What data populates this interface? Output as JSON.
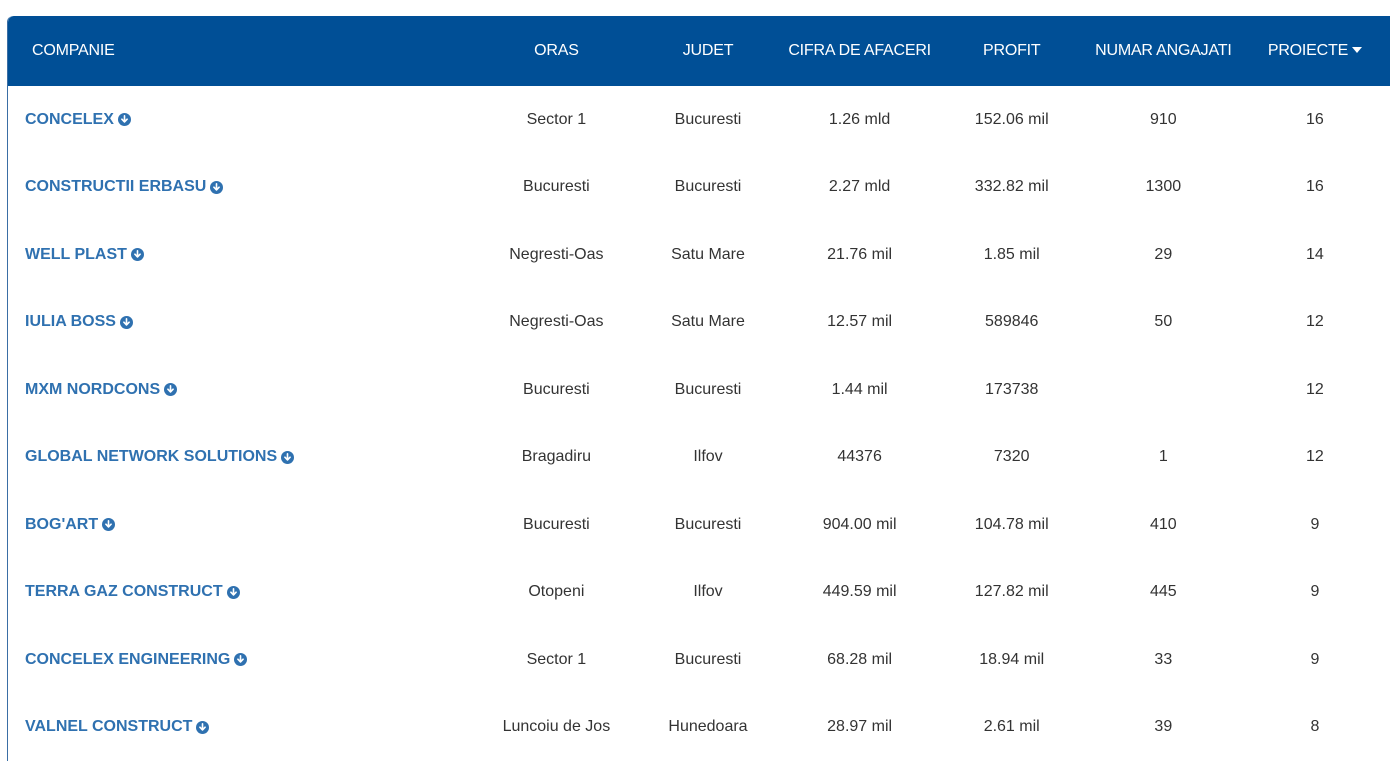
{
  "headers": {
    "company": "COMPANIE",
    "oras": "ORAS",
    "judet": "JUDET",
    "cifra": "CIFRA DE AFACERI",
    "profit": "PROFIT",
    "angajati": "NUMAR ANGAJATI",
    "proiecte": "PROIECTE",
    "sort_icon": "caret-down-icon"
  },
  "rows": [
    {
      "company": "CONCELEX",
      "oras": "Sector 1",
      "judet": "Bucuresti",
      "cifra": "1.26 mld",
      "profit": "152.06 mil",
      "angajati": "910",
      "proiecte": "16"
    },
    {
      "company": "CONSTRUCTII ERBASU",
      "oras": "Bucuresti",
      "judet": "Bucuresti",
      "cifra": "2.27 mld",
      "profit": "332.82 mil",
      "angajati": "1300",
      "proiecte": "16"
    },
    {
      "company": "WELL PLAST",
      "oras": "Negresti-Oas",
      "judet": "Satu Mare",
      "cifra": "21.76 mil",
      "profit": "1.85 mil",
      "angajati": "29",
      "proiecte": "14"
    },
    {
      "company": "IULIA BOSS",
      "oras": "Negresti-Oas",
      "judet": "Satu Mare",
      "cifra": "12.57 mil",
      "profit": "589846",
      "angajati": "50",
      "proiecte": "12"
    },
    {
      "company": "MXM NORDCONS",
      "oras": "Bucuresti",
      "judet": "Bucuresti",
      "cifra": "1.44 mil",
      "profit": "173738",
      "angajati": "",
      "proiecte": "12"
    },
    {
      "company": "GLOBAL NETWORK SOLUTIONS",
      "oras": "Bragadiru",
      "judet": "Ilfov",
      "cifra": "44376",
      "profit": "7320",
      "angajati": "1",
      "proiecte": "12"
    },
    {
      "company": "BOG'ART",
      "oras": "Bucuresti",
      "judet": "Bucuresti",
      "cifra": "904.00 mil",
      "profit": "104.78 mil",
      "angajati": "410",
      "proiecte": "9"
    },
    {
      "company": "TERRA GAZ CONSTRUCT",
      "oras": "Otopeni",
      "judet": "Ilfov",
      "cifra": "449.59 mil",
      "profit": "127.82 mil",
      "angajati": "445",
      "proiecte": "9"
    },
    {
      "company": "CONCELEX ENGINEERING",
      "oras": "Sector 1",
      "judet": "Bucuresti",
      "cifra": "68.28 mil",
      "profit": "18.94 mil",
      "angajati": "33",
      "proiecte": "9"
    },
    {
      "company": "VALNEL CONSTRUCT",
      "oras": "Luncoiu de Jos",
      "judet": "Hunedoara",
      "cifra": "28.97 mil",
      "profit": "2.61 mil",
      "angajati": "39",
      "proiecte": "8"
    }
  ],
  "colors": {
    "header_bg": "#004f96",
    "link": "#2f71b0",
    "text": "#333333"
  },
  "company_icon": "circle-arrow-down-icon"
}
